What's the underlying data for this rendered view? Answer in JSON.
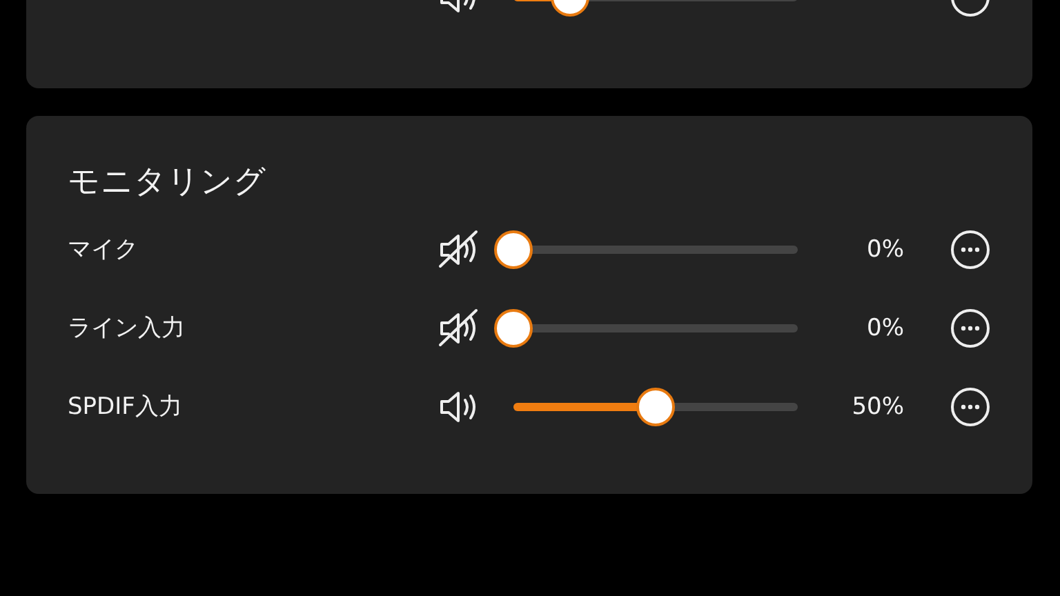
{
  "top_card": {
    "channels": [
      {
        "muted": false,
        "level": 0.2
      }
    ]
  },
  "monitoring": {
    "title": "モニタリング",
    "channels": [
      {
        "name": "マイク",
        "muted": true,
        "level": 0,
        "reading": "0%"
      },
      {
        "name": "ライン入力",
        "muted": true,
        "level": 0,
        "reading": "0%"
      },
      {
        "name": "SPDIF入力",
        "muted": false,
        "level": 0.5,
        "reading": "50%"
      }
    ]
  }
}
